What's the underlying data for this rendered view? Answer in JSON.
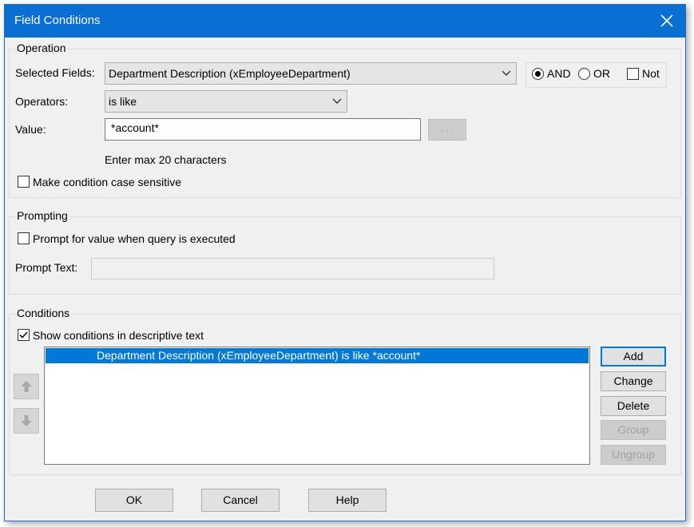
{
  "window": {
    "title": "Field Conditions",
    "close_icon": "close-icon"
  },
  "operation": {
    "group_title": "Operation",
    "selected_fields_label": "Selected Fields:",
    "selected_field_value": "Department Description (xEmployeeDepartment)",
    "and_label": "AND",
    "or_label": "OR",
    "not_label": "Not",
    "logic_selected": "AND",
    "not_checked": false,
    "operators_label": "Operators:",
    "operator_value": "is like",
    "value_label": "Value:",
    "value_text": "*account*",
    "browse_label": ". . .",
    "hint": "Enter max 20 characters",
    "case_sensitive_label": "Make condition case sensitive",
    "case_sensitive_checked": false
  },
  "prompting": {
    "group_title": "Prompting",
    "prompt_checkbox_label": "Prompt for value when query is executed",
    "prompt_checked": false,
    "prompt_text_label": "Prompt Text:",
    "prompt_text_value": ""
  },
  "conditions": {
    "group_title": "Conditions",
    "show_desc_label": "Show conditions in descriptive text",
    "show_desc_checked": true,
    "items": [
      "Department Description (xEmployeeDepartment) is like *account*"
    ],
    "buttons": {
      "add": "Add",
      "change": "Change",
      "delete": "Delete",
      "group": "Group",
      "ungroup": "Ungroup"
    },
    "move_up_icon": "arrow-up-icon",
    "move_down_icon": "arrow-down-icon"
  },
  "footer": {
    "ok": "OK",
    "cancel": "Cancel",
    "help": "Help"
  },
  "colors": {
    "titlebar": "#0a6fd3",
    "selection": "#0078d7",
    "dialog_bg": "#f0f0f0"
  }
}
